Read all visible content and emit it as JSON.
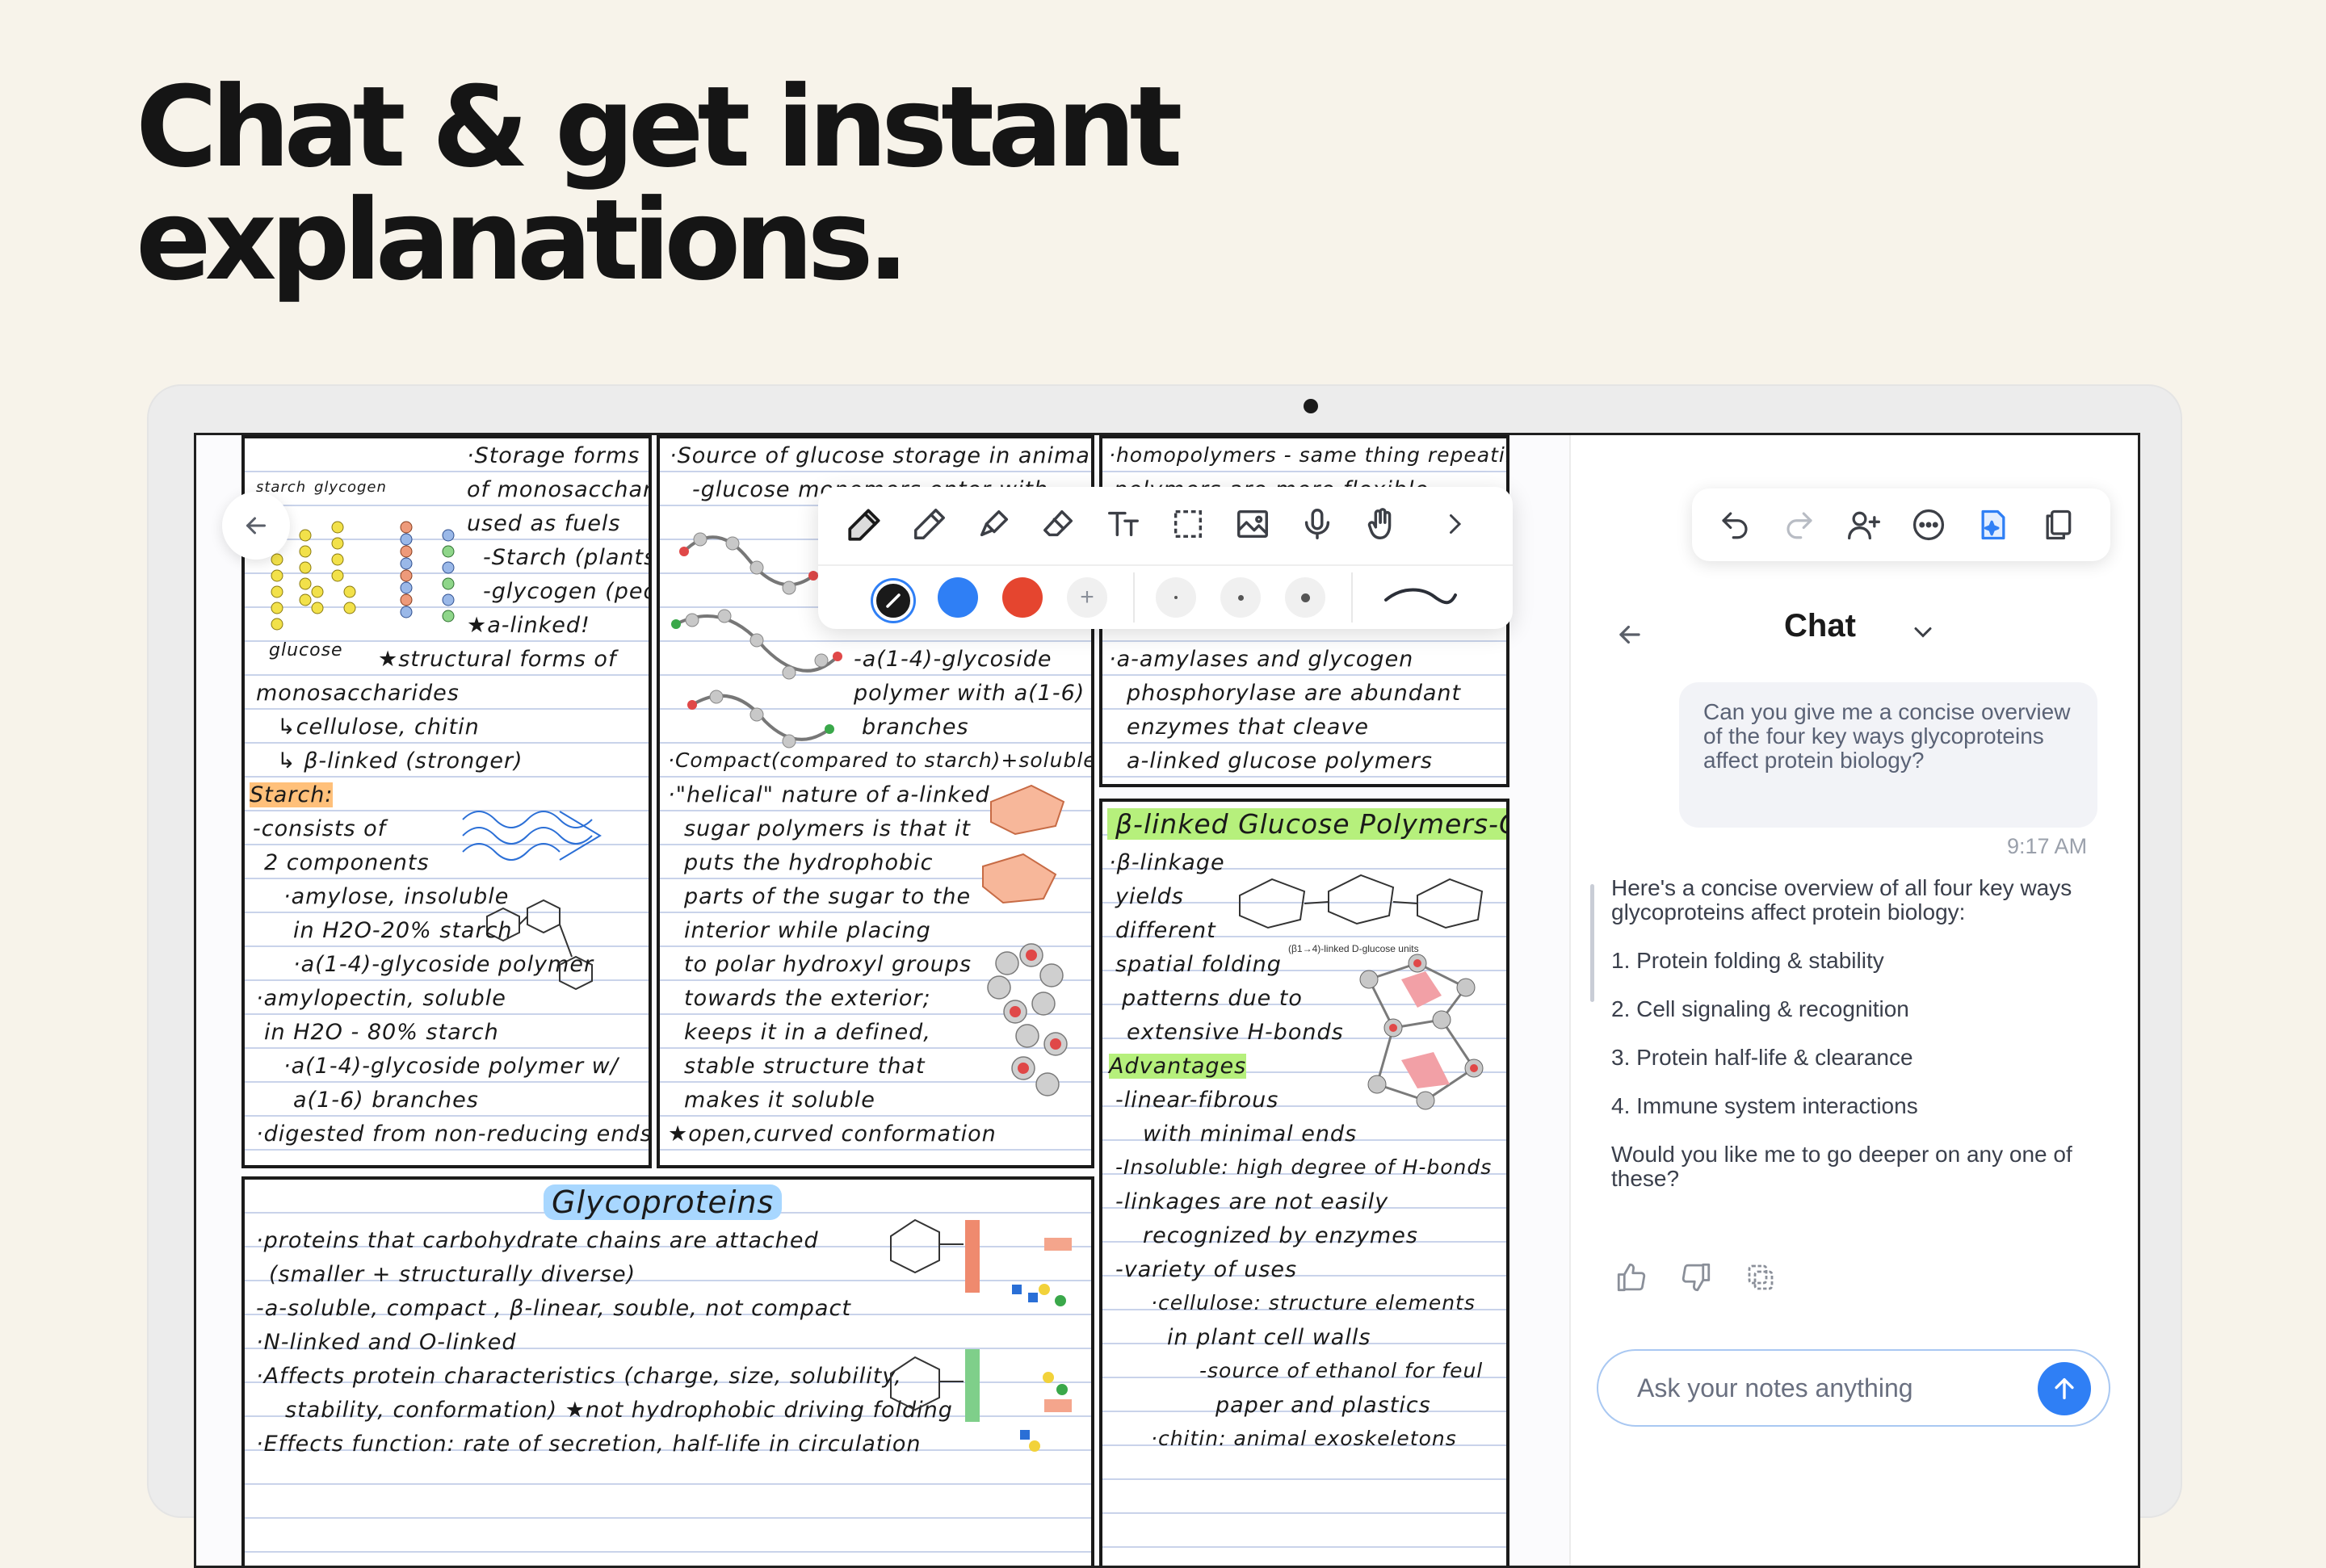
{
  "headline": {
    "line1": "Chat & get instant",
    "line2": "explanations."
  },
  "notes": {
    "panel1": [
      "·Storage forms",
      "of monosaccharides",
      "used as fuels",
      "-Starch (plants)",
      "-glycogen (people)",
      "★a-linked!",
      "★structural forms of",
      "monosaccharides",
      "↳cellulose, chitin",
      "↳ β-linked (stronger)",
      "Starch:",
      "-consists of",
      "2 components",
      "·amylose, insoluble",
      "in H2O-20% starch",
      "·a(1-4)-glycoside polymer",
      "·amylopectin, soluble",
      "in H2O - 80% starch",
      "·a(1-4)-glycoside polymer w/",
      "a(1-6) branches",
      "·digested from non-reducing ends"
    ],
    "panel1_labels": {
      "starch": "starch",
      "glycogen": "glycogen",
      "glucose": "glucose"
    },
    "panel2": [
      "·Source of glucose storage in animals",
      "-glucose monomers enter with",
      "-a(1-4)-glycoside",
      "polymer with a(1-6)",
      "branches",
      "·Compact(compared to starch)+soluble",
      "·\"helical\" nature of a-linked",
      "sugar polymers is that it",
      "puts the hydrophobic",
      "parts of the sugar to the",
      "interior while placing",
      "to polar hydroxyl groups",
      "towards the exterior;",
      "keeps it in a defined,",
      "stable structure that",
      "makes it soluble",
      "★open,curved conformation"
    ],
    "panel3": [
      "·homopolymers - same thing repeating",
      "polymers are more flexible",
      "·a-amylases and glycogen",
      "phosphorylase are abundant",
      "enzymes that cleave",
      "a-linked glucose polymers"
    ],
    "panel4_title": "β-linked Glucose Polymers-Cellulose",
    "panel4": [
      "·β-linkage",
      "yields",
      "different",
      "spatial folding",
      "patterns due to",
      "extensive H-bonds",
      "Advantages",
      "-linear-fibrous",
      "with minimal ends",
      "-Insoluble: high degree of H-bonds",
      "-linkages are not easily",
      "recognized by enzymes",
      "-variety of uses",
      "·cellulose: structure elements",
      "in plant cell walls",
      "-source of ethanol for feul",
      "paper and plastics",
      "·chitin: animal exoskeletons"
    ],
    "panel4_fig_caption": "(β1→4)-linked D-glucose units",
    "panel5_title": "Glycoproteins",
    "panel5": [
      "·proteins that carbohydrate chains are attached",
      "(smaller + structurally diverse)",
      "-a-soluble, compact , β-linear, souble, not compact",
      "·N-linked and O-linked",
      "·Affects protein characteristics (charge, size, solubility,",
      "stability, conformation) ★not hydrophobic driving folding",
      "·Effects function: rate of secretion, half-life in circulation"
    ]
  },
  "toolbar": {
    "tools": [
      "pen-icon",
      "pencil-icon",
      "highlighter-icon",
      "eraser-icon",
      "text-icon",
      "lasso-select-icon",
      "image-icon",
      "microphone-icon",
      "hand-pointer-icon",
      "chevron-right-icon"
    ],
    "colors": [
      "#1a1a1a",
      "#2f7ff5",
      "#e5452f"
    ],
    "add_color_label": "+"
  },
  "chat_toolbar": {
    "icons": [
      "undo-icon",
      "redo-icon",
      "add-person-icon",
      "more-icon",
      "ai-notes-icon",
      "copy-pages-icon"
    ]
  },
  "chat": {
    "title": "Chat",
    "user_message": "Can you give me a concise overview of the four key ways glycoproteins affect protein biology?",
    "time": "9:17 AM",
    "ai_intro": "Here's a concise overview of all four key ways glycoproteins affect protein biology:",
    "ai_items": [
      "1. Protein folding & stability",
      "2. Cell signaling & recognition",
      "3. Protein half-life & clearance",
      "4. Immune system interactions"
    ],
    "ai_followup": "Would you like me to go deeper on any one of these?",
    "input_placeholder": "Ask your notes anything"
  }
}
